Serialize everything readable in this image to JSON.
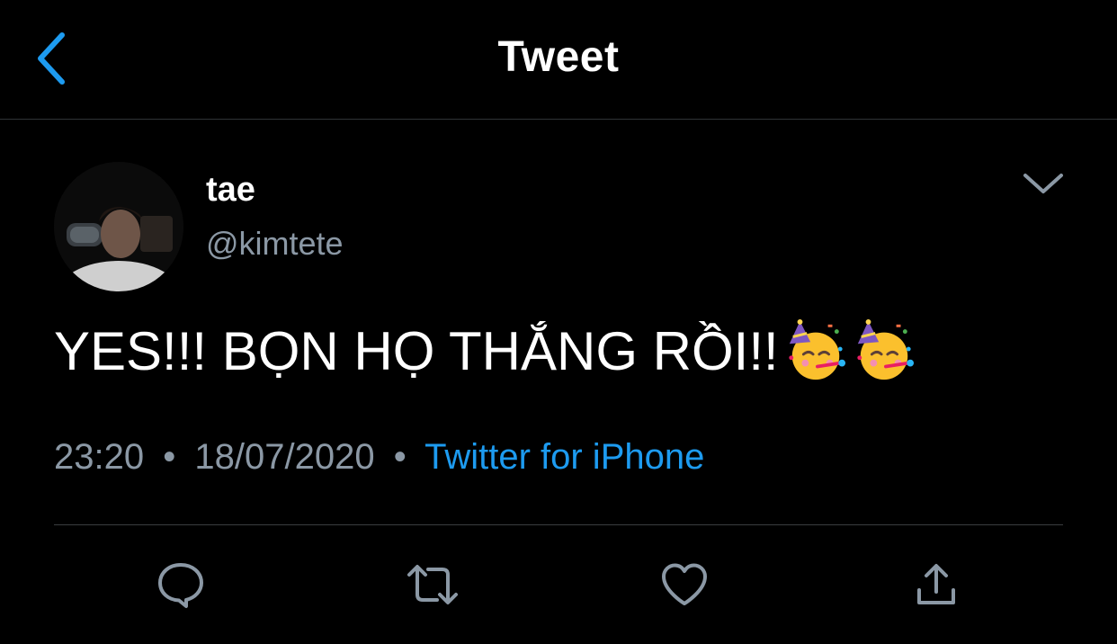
{
  "nav": {
    "title": "Tweet",
    "back_icon": "chevron-left-icon"
  },
  "tweet": {
    "author": {
      "display_name": "tae",
      "handle": "@kimtete"
    },
    "text": "YES!!! BỌN HỌ THẮNG RỒI!!",
    "emojis": [
      "partying-face-emoji",
      "partying-face-emoji"
    ],
    "time": "23:20",
    "date": "18/07/2020",
    "separator": "•",
    "source": "Twitter for iPhone"
  },
  "actions": [
    {
      "icon": "reply-icon"
    },
    {
      "icon": "retweet-icon"
    },
    {
      "icon": "like-icon"
    },
    {
      "icon": "share-icon"
    }
  ],
  "colors": {
    "background": "#000000",
    "accent": "#1d9bf0",
    "secondary_text": "#8b98a5",
    "icon": "#8b98a5"
  }
}
